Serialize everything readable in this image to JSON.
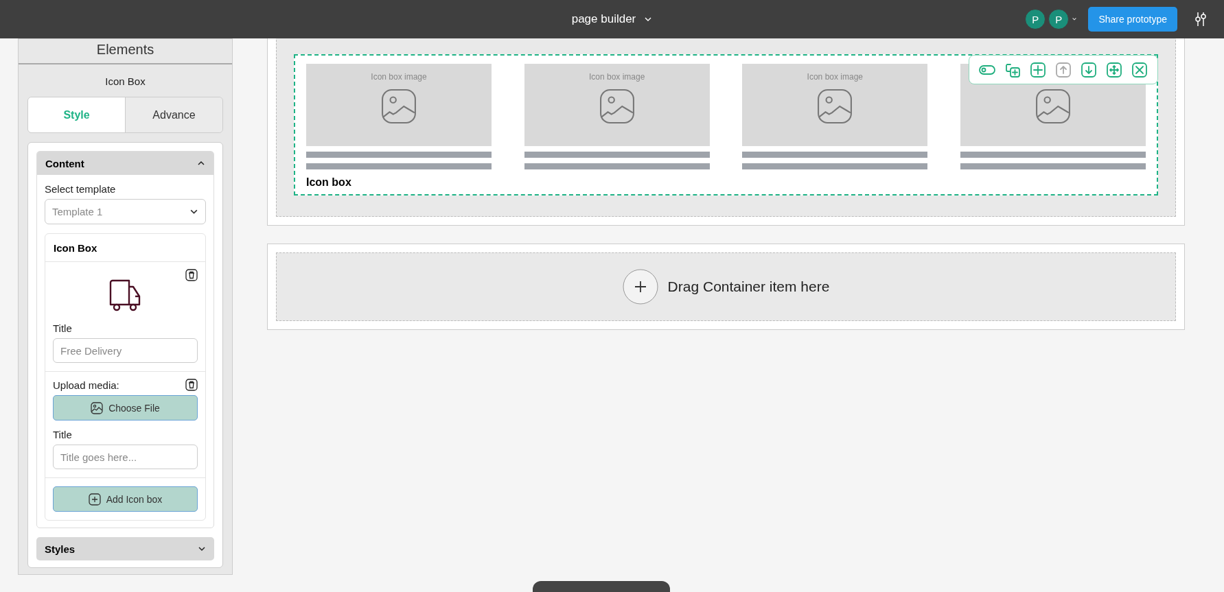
{
  "top_bar": {
    "title": "page builder",
    "avatars": [
      "P",
      "P"
    ],
    "share_button": "Share prototype"
  },
  "panel": {
    "heading": "Elements",
    "subheading": "Icon Box",
    "tabs": [
      {
        "label": "Style",
        "selected": true
      },
      {
        "label": "Advance",
        "selected": false
      }
    ],
    "content_section": {
      "title": "Content",
      "expanded": true,
      "template_label": "Select template",
      "template_value": "Template 1",
      "item": {
        "title": "Icon Box",
        "title_label": "Title",
        "title_placeholder": "Free Delivery",
        "upload_label": "Upload media:",
        "choose_file": "Choose File",
        "second_title_label": "Title",
        "second_title_placeholder": "Title goes here..."
      },
      "add_button": "Add Icon box"
    },
    "styles_section": {
      "title": "Styles",
      "expanded": false
    }
  },
  "canvas": {
    "widget_label": "Icon box",
    "cards": [
      {
        "kind": "labelled",
        "image_label": "Icon box image"
      },
      {
        "kind": "labelled",
        "image_label": "Icon box image"
      },
      {
        "kind": "labelled",
        "image_label": "Icon box image"
      },
      {
        "kind": "covered"
      }
    ],
    "toolbar": [
      {
        "kind": "toggle",
        "disabled": false
      },
      {
        "kind": "duplicate",
        "disabled": false
      },
      {
        "kind": "add",
        "disabled": false
      },
      {
        "kind": "up",
        "disabled": true
      },
      {
        "kind": "down",
        "disabled": false
      },
      {
        "kind": "move",
        "disabled": false
      },
      {
        "kind": "close",
        "disabled": false
      }
    ],
    "drop_zone": "Drag Container item here"
  }
}
